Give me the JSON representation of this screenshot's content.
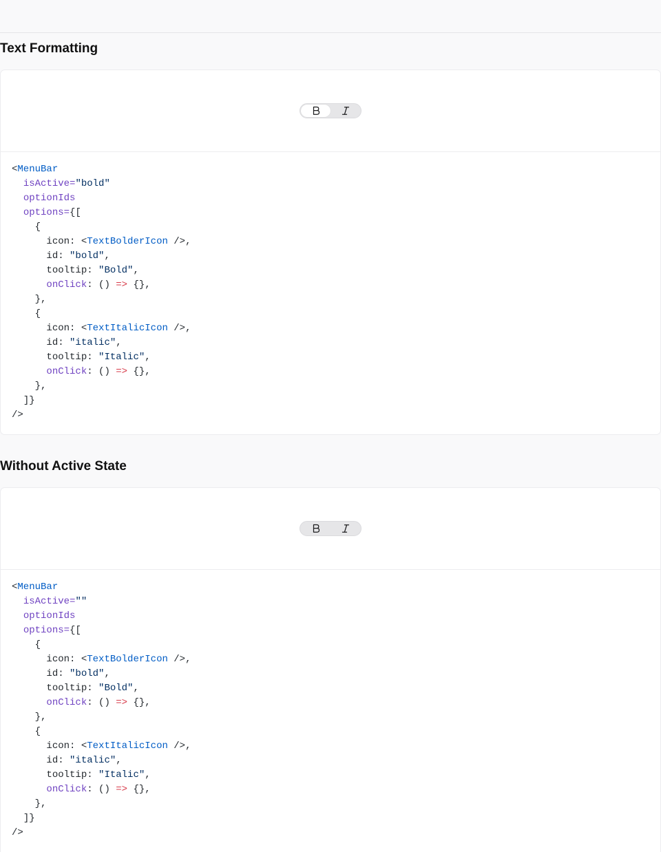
{
  "sections": [
    {
      "title": "Text Formatting",
      "menubar": {
        "active": "bold",
        "options": [
          {
            "id": "bold",
            "tooltip": "Bold",
            "icon": "text-bold-icon"
          },
          {
            "id": "italic",
            "tooltip": "Italic",
            "icon": "text-italic-icon"
          }
        ]
      },
      "code": {
        "component": "MenuBar",
        "is_active_value": "\"bold\"",
        "icon_bold": "TextBolderIcon",
        "icon_italic": "TextItalicIcon",
        "id_bold": "\"bold\"",
        "id_italic": "\"italic\"",
        "tooltip_bold": "\"Bold\"",
        "tooltip_italic": "\"Italic\""
      }
    },
    {
      "title": "Without Active State",
      "menubar": {
        "active": "",
        "options": [
          {
            "id": "bold",
            "tooltip": "Bold",
            "icon": "text-bold-icon"
          },
          {
            "id": "italic",
            "tooltip": "Italic",
            "icon": "text-italic-icon"
          }
        ]
      },
      "code": {
        "component": "MenuBar",
        "is_active_value": "\"\"",
        "icon_bold": "TextBolderIcon",
        "icon_italic": "TextItalicIcon",
        "id_bold": "\"bold\"",
        "id_italic": "\"italic\"",
        "tooltip_bold": "\"Bold\"",
        "tooltip_italic": "\"Italic\""
      }
    }
  ],
  "code_tokens": {
    "open_lt": "<",
    "attr_is_active": "isActive",
    "eq": "=",
    "attr_option_ids": "optionIds",
    "attr_options": "options",
    "open_arr": "{[",
    "brace_open": "{",
    "icon_key": "icon: ",
    "self_close": " />,",
    "id_key": "id: ",
    "tooltip_key": "tooltip: ",
    "onclick_key": "onClick",
    "arrow_pre": ": () ",
    "arrow": "=>",
    "arrow_post": " {},",
    "brace_close": "},",
    "comma": ",",
    "close_arr": "]}",
    "close_tag": "/>"
  },
  "colors": {
    "tag": "#005cc5",
    "attr": "#6f42c1",
    "string": "#032f62",
    "keyword": "#d73a49"
  }
}
